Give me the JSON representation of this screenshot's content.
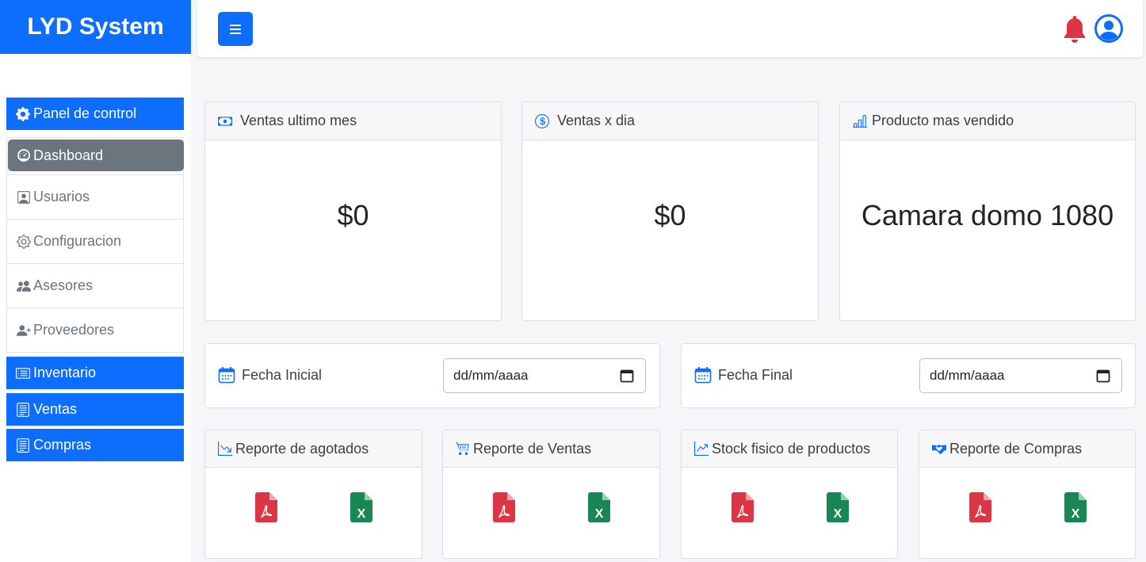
{
  "brand": "LYD System",
  "sidebar": {
    "panel": "Panel de control",
    "submenu": [
      "Dashboard",
      "Usuarios",
      "Configuracion",
      "Asesores",
      "Proveedores"
    ],
    "inventario": "Inventario",
    "ventas": "Ventas",
    "compras": "Compras"
  },
  "stats": [
    {
      "title": "Ventas ultimo mes",
      "value": "$0"
    },
    {
      "title": "Ventas x dia",
      "value": "$0"
    },
    {
      "title": "Producto mas vendido",
      "value": "Camara domo 1080"
    }
  ],
  "dates": [
    {
      "label": "Fecha Inicial",
      "placeholder": "dd/mm/aaaa"
    },
    {
      "label": "Fecha Final",
      "placeholder": "dd/mm/aaaa"
    }
  ],
  "reports": [
    {
      "title": "Reporte de agotados"
    },
    {
      "title": "Reporte de Ventas"
    },
    {
      "title": "Stock fisico de productos"
    },
    {
      "title": "Reporte de Compras"
    }
  ],
  "colors": {
    "primary": "#0d6efd",
    "danger": "#dc3545",
    "success": "#198754",
    "secondary": "#6c757d"
  }
}
